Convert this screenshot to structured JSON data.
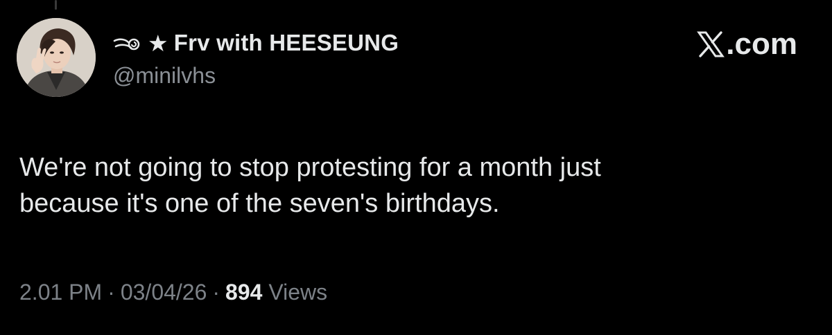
{
  "thread_connector": true,
  "author": {
    "display_name": "Frv with HEESEUNG",
    "name_prefix_icons": [
      "wind-swirl-icon",
      "black-star-icon"
    ],
    "star_glyph": "★",
    "handle": "@minilvhs",
    "avatar": "profile-photo"
  },
  "brand": {
    "logo_letter": "X",
    "domain_suffix": ".com"
  },
  "tweet": {
    "text_lines": [
      "We're not going to stop protesting for a month just",
      "because it's one of the seven's birthdays."
    ]
  },
  "meta": {
    "time": "2.01 PM",
    "separator": "·",
    "date": "03/04/26",
    "views_count": "894",
    "views_label": "Views"
  },
  "colors": {
    "background": "#000000",
    "primary_text": "#e7e9ea",
    "secondary_text": "#7d8288"
  }
}
